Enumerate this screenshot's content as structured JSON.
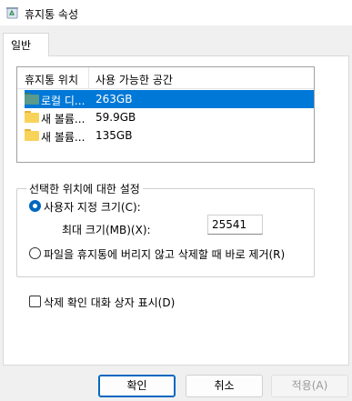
{
  "window": {
    "title": "휴지통 속성",
    "icon": "recycle-bin-icon"
  },
  "tabs": [
    {
      "label": "일반"
    }
  ],
  "list": {
    "columns": [
      "휴지통 위치",
      "사용 가능한 공간"
    ],
    "rows": [
      {
        "name": "로컬 디...",
        "space": "263GB",
        "icon": "drive-folder-icon",
        "selected": true
      },
      {
        "name": "새 볼륨...",
        "space": "59.9GB",
        "icon": "folder-icon",
        "selected": false
      },
      {
        "name": "새 볼륨...",
        "space": "135GB",
        "icon": "folder-icon",
        "selected": false
      }
    ]
  },
  "settings": {
    "group_label": "선택한 위치에 대한 설정",
    "custom_size_label": "사용자 지정 크기(C):",
    "max_size_label": "최대 크기(MB)(X):",
    "max_size_value": "25541",
    "delete_immediately_label": "파일을 휴지통에 버리지 않고 삭제할 때 바로 제거(R)",
    "custom_size_checked": true
  },
  "confirm": {
    "label": "삭제 확인 대화 상자 표시(D)",
    "checked": false
  },
  "buttons": {
    "ok": "확인",
    "cancel": "취소",
    "apply": "적용(A)"
  },
  "colors": {
    "accent": "#0078d7",
    "primary_border": "#0067c0"
  }
}
